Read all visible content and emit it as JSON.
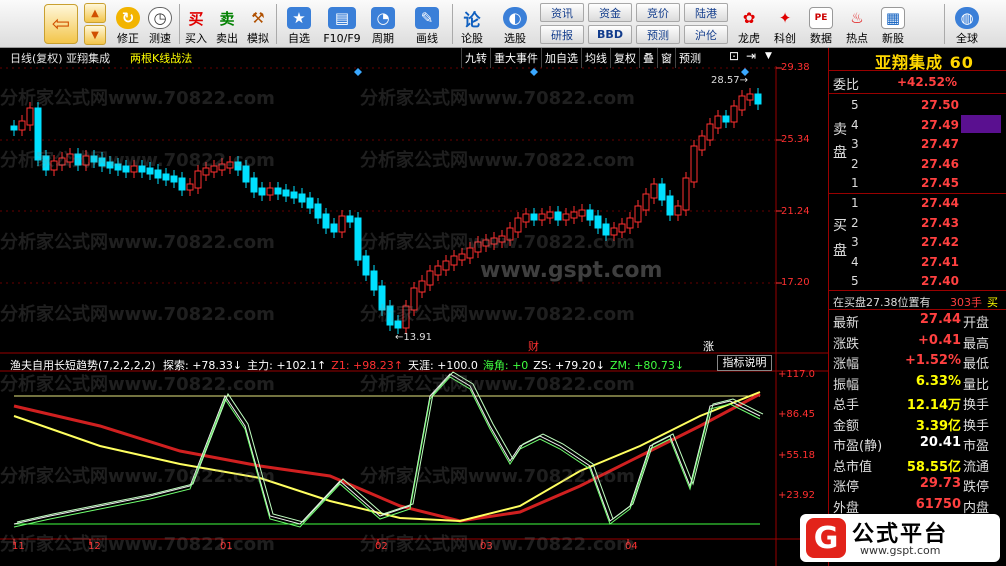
{
  "toolbar": {
    "nav": [
      {
        "icon": "back-arrow-icon"
      }
    ],
    "fix_label": "修正",
    "ce_label": "测速",
    "buy_label": "买入",
    "sell_label": "卖出",
    "sim_label": "模拟",
    "zixuan_label": "自选",
    "f10_label": "F10/F9",
    "period_label": "周期",
    "draw_label": "画线",
    "lungu_label": "论股",
    "xuangu_label": "选股",
    "chips": [
      "资讯",
      "资金",
      "竞价",
      "陆港",
      "研报",
      "BBD",
      "预测",
      "沪伦"
    ],
    "longhu_label": "龙虎",
    "kechuang_label": "科创",
    "data_label": "数据",
    "hot_label": "热点",
    "newstock_label": "新股",
    "global_label": "全球"
  },
  "header": {
    "title": "日线(复权)  亚翔集成",
    "strategy": "两根K线战法",
    "tabs": [
      "九转",
      "重大事件",
      "加自选",
      "均线",
      "复权",
      "叠",
      "窗",
      "预测"
    ]
  },
  "chart_data": {
    "type": "candlestick",
    "price_axis": [
      "29.38",
      "25.34",
      "21.24",
      "17.20"
    ],
    "high_marker": "28.57",
    "low_marker": "13.91",
    "event_labels": [
      "财",
      "涨"
    ],
    "indicator": {
      "name": "渔夫自用长短趋势(7,2,2,2,2)",
      "values": [
        {
          "label": "探索:",
          "value": "+78.33",
          "arrow": "↓",
          "color": "#ffffff"
        },
        {
          "label": "主力:",
          "value": "+102.1",
          "arrow": "↑",
          "color": "#ffffff"
        },
        {
          "label": "Z1:",
          "value": "+98.23",
          "arrow": "↑",
          "color": "#ff3030"
        },
        {
          "label": "天涯:",
          "value": "+100.0",
          "arrow": "",
          "color": "#ffffff"
        },
        {
          "label": "海角:",
          "value": "+0",
          "arrow": "",
          "color": "#40ff40"
        },
        {
          "label": "ZS:",
          "value": "+79.20",
          "arrow": "↓",
          "color": "#ffffff"
        },
        {
          "label": "ZM:",
          "value": "+80.73",
          "arrow": "↓",
          "color": "#40ff40"
        }
      ],
      "axis": [
        "+117.0",
        "+86.45",
        "+55.18",
        "+23.92"
      ],
      "button": "指标说明"
    },
    "dates": [
      "11",
      "12",
      "01",
      "02",
      "03",
      "04"
    ]
  },
  "quote": {
    "stock_title": "亚翔集成 60",
    "weibi_label": "委比",
    "weibi_value": "+42.52%",
    "sell_label": [
      "卖",
      "盘"
    ],
    "buy_label": [
      "买",
      "盘"
    ],
    "sells": [
      {
        "n": "5",
        "p": "27.50"
      },
      {
        "n": "4",
        "p": "27.49"
      },
      {
        "n": "3",
        "p": "27.47"
      },
      {
        "n": "2",
        "p": "27.46"
      },
      {
        "n": "1",
        "p": "27.45"
      }
    ],
    "buys": [
      {
        "n": "1",
        "p": "27.44"
      },
      {
        "n": "2",
        "p": "27.43"
      },
      {
        "n": "3",
        "p": "27.42"
      },
      {
        "n": "4",
        "p": "27.41"
      },
      {
        "n": "5",
        "p": "27.40"
      }
    ],
    "order_note": "在买盘27.38位置有",
    "order_qty": "303手",
    "order_side": "买",
    "stats": [
      {
        "l": "最新",
        "v": "27.44",
        "k": "开盘",
        "c": "#ff4040"
      },
      {
        "l": "涨跌",
        "v": "+0.41",
        "k": "最高",
        "c": "#ff4040"
      },
      {
        "l": "涨幅",
        "v": "+1.52%",
        "k": "最低",
        "c": "#ff4040"
      },
      {
        "l": "振幅",
        "v": "6.33%",
        "k": "量比",
        "c": "#ffff00"
      },
      {
        "l": "总手",
        "v": "12.14万",
        "k": "换手",
        "c": "#ffff00"
      },
      {
        "l": "金额",
        "v": "3.39亿",
        "k": "换手",
        "c": "#ffff00"
      },
      {
        "l": "市盈(静)",
        "v": "20.41",
        "k": "市盈",
        "c": "#ffffff"
      },
      {
        "l": "总市值",
        "v": "58.55亿",
        "k": "流通",
        "c": "#ffff00"
      },
      {
        "l": "涨停",
        "v": "29.73",
        "k": "跌停",
        "c": "#ff4040"
      },
      {
        "l": "外盘",
        "v": "61750",
        "k": "内盘",
        "c": "#ff4040"
      }
    ]
  },
  "watermarks": [
    "分析家公式网www.70822.com",
    "www.gspt.com"
  ],
  "logo": {
    "main": "公式平台",
    "sub": "www.gspt.com"
  }
}
